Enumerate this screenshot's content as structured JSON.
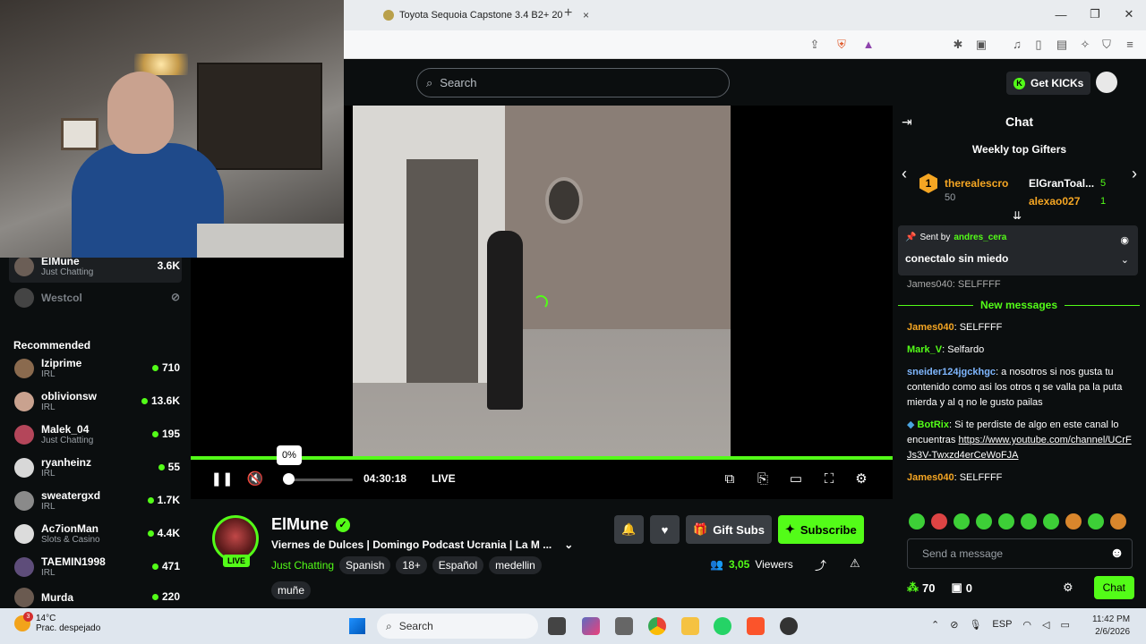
{
  "browser": {
    "tab_title": "Toyota Sequoia Capstone 3.4 B2+ 20",
    "new_tab": "+",
    "close_tab": "×",
    "window": {
      "minimize": "—",
      "maximize": "❐",
      "close": "✕"
    }
  },
  "header": {
    "search_placeholder": "Search",
    "get_kicks": "Get KICKs",
    "kicks_logo": "K"
  },
  "sidebar": {
    "following": [
      {
        "name": "ElMune",
        "category": "Just Chatting",
        "viewers": "3.6K",
        "active": true
      },
      {
        "name": "Westcol",
        "category": "",
        "viewers": "",
        "offline": true
      }
    ],
    "recommended_title": "Recommended",
    "recommended": [
      {
        "name": "Iziprime",
        "category": "IRL",
        "viewers": "710"
      },
      {
        "name": "oblivionsw",
        "category": "IRL",
        "viewers": "13.6K"
      },
      {
        "name": "Malek_04",
        "category": "Just Chatting",
        "viewers": "195"
      },
      {
        "name": "ryanheinz",
        "category": "IRL",
        "viewers": "55"
      },
      {
        "name": "sweatergxd",
        "category": "IRL",
        "viewers": "1.7K"
      },
      {
        "name": "Ac7ionMan",
        "category": "Slots & Casino",
        "viewers": "4.4K"
      },
      {
        "name": "TAEMIN1998",
        "category": "IRL",
        "viewers": "471"
      },
      {
        "name": "Murda",
        "category": "",
        "viewers": "220"
      }
    ]
  },
  "player": {
    "volume_tooltip": "0%",
    "volume_level": 0,
    "elapsed": "04:30:18",
    "live_label": "LIVE",
    "buffering": true
  },
  "stream": {
    "channel": "ElMune",
    "live_badge": "LIVE",
    "title": "Viernes de Dulces | Domingo Podcast Ucrania | La M ...",
    "category": "Just Chatting",
    "tags": [
      "Spanish",
      "18+",
      "Español",
      "medellin",
      "muñe"
    ],
    "gift_subs": "Gift Subs",
    "subscribe": "Subscribe",
    "viewers_count": "3,05",
    "viewers_label": "Viewers"
  },
  "chat": {
    "title": "Chat",
    "gifters_title": "Weekly top Gifters",
    "gifters": [
      {
        "rank": "1",
        "name": "therealescro",
        "count": "50"
      },
      {
        "name": "ElGranToal...",
        "count": "5"
      },
      {
        "name": "alexao027",
        "count": "1"
      }
    ],
    "pinned": {
      "sent_by": "Sent by",
      "user": "andres_cera",
      "message": "conectalo sin miedo",
      "hidden_snippet": "James040: SELFFFF"
    },
    "new_messages": "New messages",
    "messages": [
      {
        "user": "James040",
        "text": ": SELFFFF",
        "color": "#f5a623"
      },
      {
        "user": "Mark_V",
        "text": ": Selfardo",
        "color": "#53fc18"
      },
      {
        "user": "sneider124jgckhgc",
        "text": ": a nosotros si nos gusta tu contenido como asi los otros q se valla pa la puta mierda y al q no le gusto pailas",
        "color": "#7fb7ff"
      },
      {
        "user": "BotRix",
        "text": ": Si te perdiste de algo en este canal lo encuentras ",
        "link": "https://www.youtube.com/channel/UCrFJs3V-Twxzd4erCeWoFJA",
        "color": "#53fc18"
      },
      {
        "user": "James040",
        "text": ": SELFFFF",
        "color": "#f5a623"
      }
    ],
    "input_placeholder": "Send a message",
    "points": "70",
    "gifts": "0",
    "chat_button": "Chat"
  },
  "taskbar": {
    "temp": "14°C",
    "weather": "Prac. despejado",
    "weather_badge": "3",
    "search": "Search",
    "lang": "ESP",
    "time": "11:42 PM",
    "date": "2/6/2026"
  },
  "colors": {
    "accent": "#53fc18",
    "bg": "#0b0e0f",
    "panel": "#24272b"
  }
}
